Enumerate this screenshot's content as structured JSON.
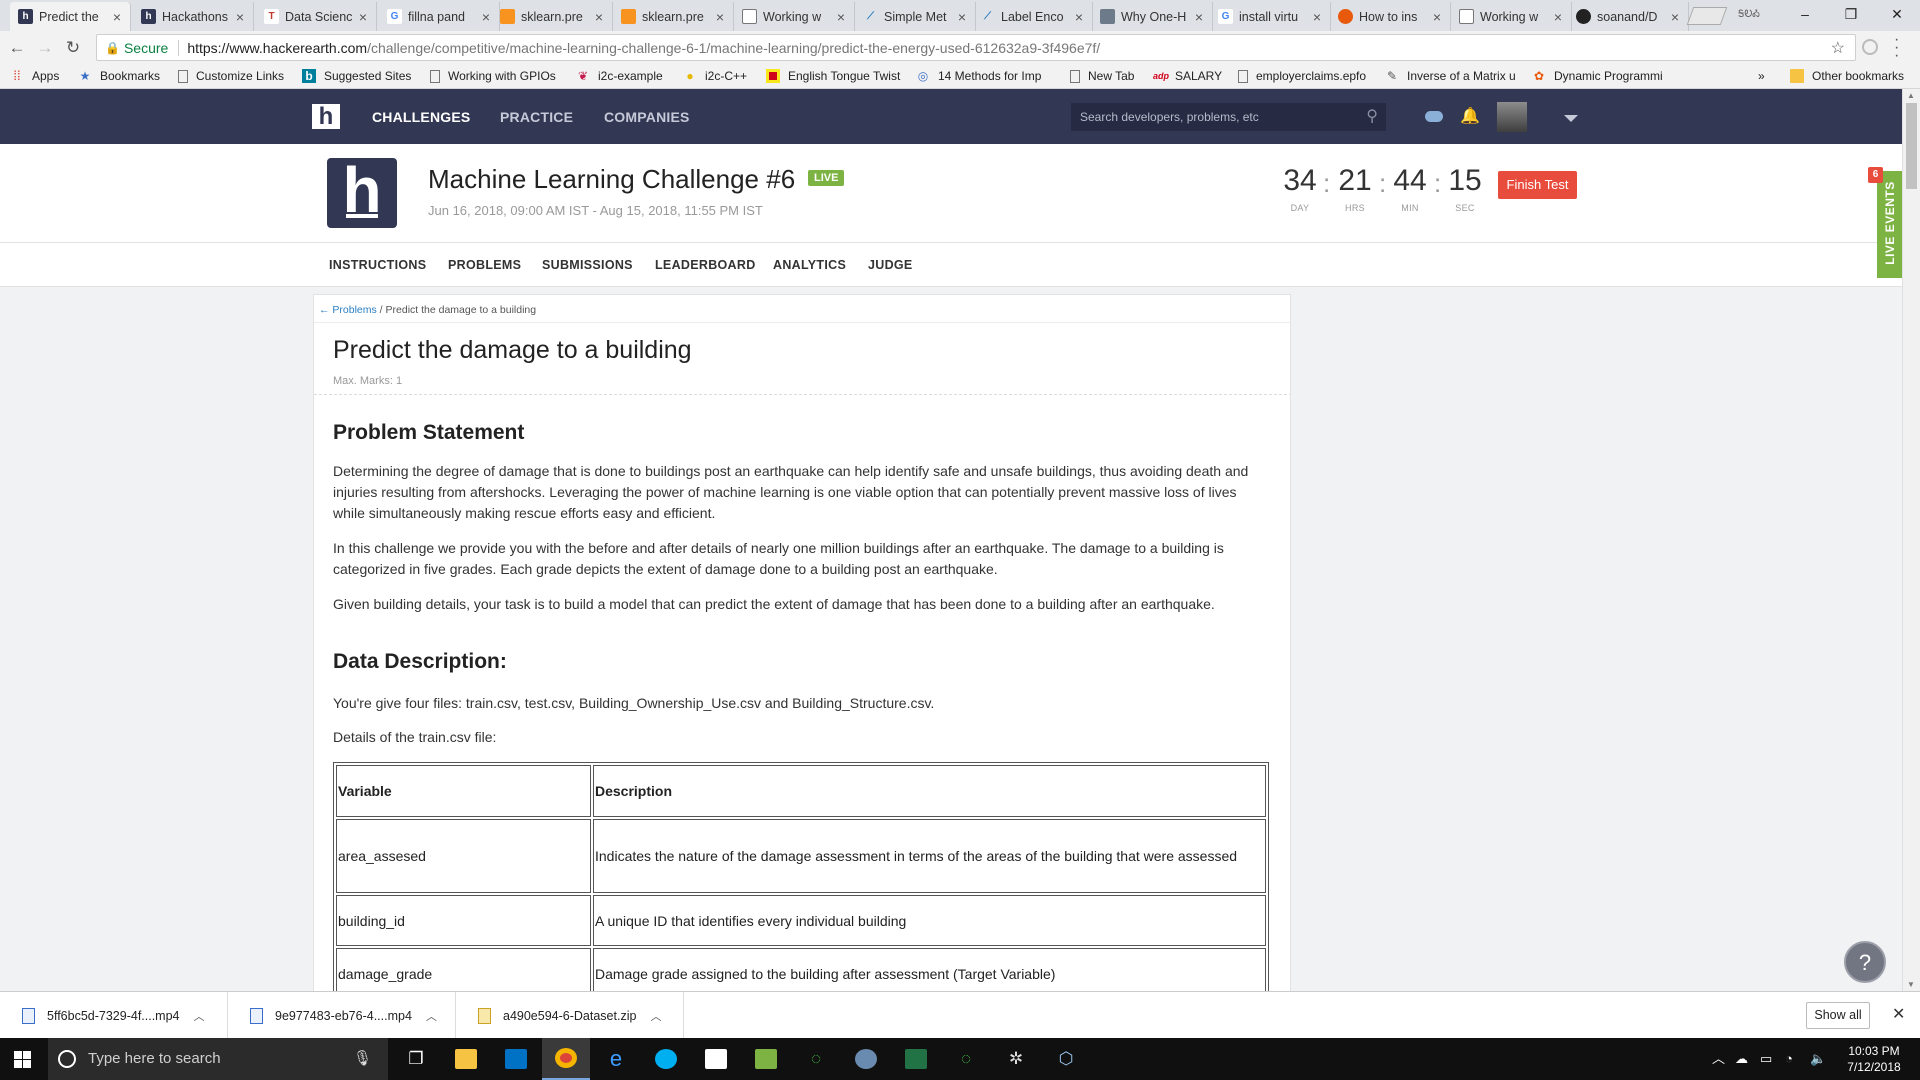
{
  "browser": {
    "tabs": [
      {
        "title": "Predict the",
        "icon": "hackerearth-icon",
        "color": "#323754",
        "active": true
      },
      {
        "title": "Hackathons",
        "icon": "hackerearth-icon",
        "color": "#323754"
      },
      {
        "title": "Data Scienc",
        "icon": "tg-icon",
        "color": "#c0392b"
      },
      {
        "title": "fillna pand",
        "icon": "google-icon",
        "color": "#ffffff"
      },
      {
        "title": "sklearn.pre",
        "icon": "sklearn-icon",
        "color": "#f7931e"
      },
      {
        "title": "sklearn.pre",
        "icon": "sklearn-icon",
        "color": "#f7931e"
      },
      {
        "title": "Working w",
        "icon": "page-icon",
        "color": "#ffffff"
      },
      {
        "title": "Simple Met",
        "icon": "chart-icon",
        "color": "#ffffff"
      },
      {
        "title": "Label Enco",
        "icon": "chart-icon",
        "color": "#ffffff"
      },
      {
        "title": "Why One-H",
        "icon": "quora-icon",
        "color": "#6c7a89"
      },
      {
        "title": "install virtu",
        "icon": "google-icon",
        "color": "#ffffff"
      },
      {
        "title": "How to ins",
        "icon": "ask-icon",
        "color": "#e8590c"
      },
      {
        "title": "Working w",
        "icon": "page-icon",
        "color": "#ffffff"
      },
      {
        "title": "soanand/D",
        "icon": "github-icon",
        "color": "#222222"
      }
    ],
    "profile_label": "ᎦᎧᎣ",
    "secure_label": "Secure",
    "url_host": "https://www.hackerearth.com",
    "url_path": "/challenge/competitive/machine-learning-challenge-6-1/machine-learning/predict-the-energy-used-612632a9-3f496e7f/",
    "bookmarks": [
      {
        "label": "Apps",
        "icon": "apps-icon"
      },
      {
        "label": "Bookmarks",
        "icon": "star-icon"
      },
      {
        "label": "Customize Links",
        "icon": "page-icon"
      },
      {
        "label": "Suggested Sites",
        "icon": "bing-icon"
      },
      {
        "label": "Working with GPIOs",
        "icon": "page-icon"
      },
      {
        "label": "i2c-example",
        "icon": "raspberry-icon"
      },
      {
        "label": "i2c-C++",
        "icon": "bulb-icon"
      },
      {
        "label": "English Tongue Twist",
        "icon": "flag-icon"
      },
      {
        "label": "14 Methods for Imp",
        "icon": "globe-icon"
      },
      {
        "label": "New Tab",
        "icon": "page-icon"
      },
      {
        "label": "SALARY",
        "icon": "adp-icon"
      },
      {
        "label": "employerclaims.epfo",
        "icon": "page-icon"
      },
      {
        "label": "Inverse of a Matrix u",
        "icon": "matrix-icon"
      },
      {
        "label": "Dynamic Programmi",
        "icon": "gfg-icon"
      }
    ],
    "more_bookmarks": "»",
    "other_bookmarks": "Other bookmarks"
  },
  "site": {
    "logo": "h",
    "nav": [
      "CHALLENGES",
      "PRACTICE",
      "COMPANIES"
    ],
    "search_placeholder": "Search developers, problems, etc"
  },
  "challenge": {
    "logo": "h",
    "title": "Machine Learning Challenge #6",
    "live_badge": "LIVE",
    "dates": "Jun 16, 2018, 09:00 AM IST - Aug 15, 2018, 11:55 PM IST",
    "timer": [
      {
        "value": "34",
        "label": "DAY"
      },
      {
        "value": "21",
        "label": "HRS"
      },
      {
        "value": "44",
        "label": "MIN"
      },
      {
        "value": "15",
        "label": "SEC"
      }
    ],
    "finish_label": "Finish Test",
    "tabs": [
      "INSTRUCTIONS",
      "PROBLEMS",
      "SUBMISSIONS",
      "LEADERBOARD",
      "ANALYTICS",
      "JUDGE"
    ],
    "live_events_label": "LIVE EVENTS",
    "live_events_count": "6"
  },
  "problem": {
    "breadcrumb_back": "← Problems",
    "breadcrumb_current": " / Predict the damage to a building",
    "title": "Predict the damage to a building",
    "max_marks": "Max. Marks: 1",
    "statement_heading": "Problem Statement",
    "paragraphs": [
      "Determining the degree of damage that is done to buildings post an earthquake can help identify safe and unsafe buildings, thus avoiding death and injuries resulting from aftershocks.  Leveraging the power of machine learning is one viable option that can potentially prevent massive loss of lives while simultaneously making rescue efforts easy and efficient.",
      "In this challenge we provide you with the before and after details of nearly one million buildings after an earthquake. The damage to a building is categorized in five grades. Each grade depicts the extent of damage done to a building post an earthquake.",
      "Given building details, your task is to build a model that can predict the extent of damage that has been done to a building after an earthquake."
    ],
    "data_heading": "Data Description:",
    "files_text": "You're give four files: train.csv, test.csv, Building_Ownership_Use.csv and Building_Structure.csv.",
    "details_text": "Details of the train.csv file:",
    "table_headers": [
      "Variable",
      "Description"
    ],
    "table_rows": [
      {
        "variable": "area_assesed",
        "description": "Indicates the nature of the damage assessment in terms of the areas of the building that were assessed"
      },
      {
        "variable": "building_id",
        "description": "A unique ID that identifies every individual building"
      },
      {
        "variable": "damage_grade",
        "description": "Damage grade assigned to the building after assessment (Target Variable)"
      }
    ],
    "help_label": "?"
  },
  "downloads": {
    "items": [
      {
        "name": "5ff6bc5d-7329-4f....mp4",
        "type": "video"
      },
      {
        "name": "9e977483-eb76-4....mp4",
        "type": "video"
      },
      {
        "name": "a490e594-6-Dataset.zip",
        "type": "zip"
      }
    ],
    "show_all": "Show all"
  },
  "taskbar": {
    "search_placeholder": "Type here to search",
    "time": "10:03 PM",
    "date": "7/12/2018"
  },
  "colors": {
    "nav_bg": "#323754",
    "live_green": "#7cb342",
    "finish_red": "#e74c3c",
    "link_blue": "#2b7fc3"
  }
}
